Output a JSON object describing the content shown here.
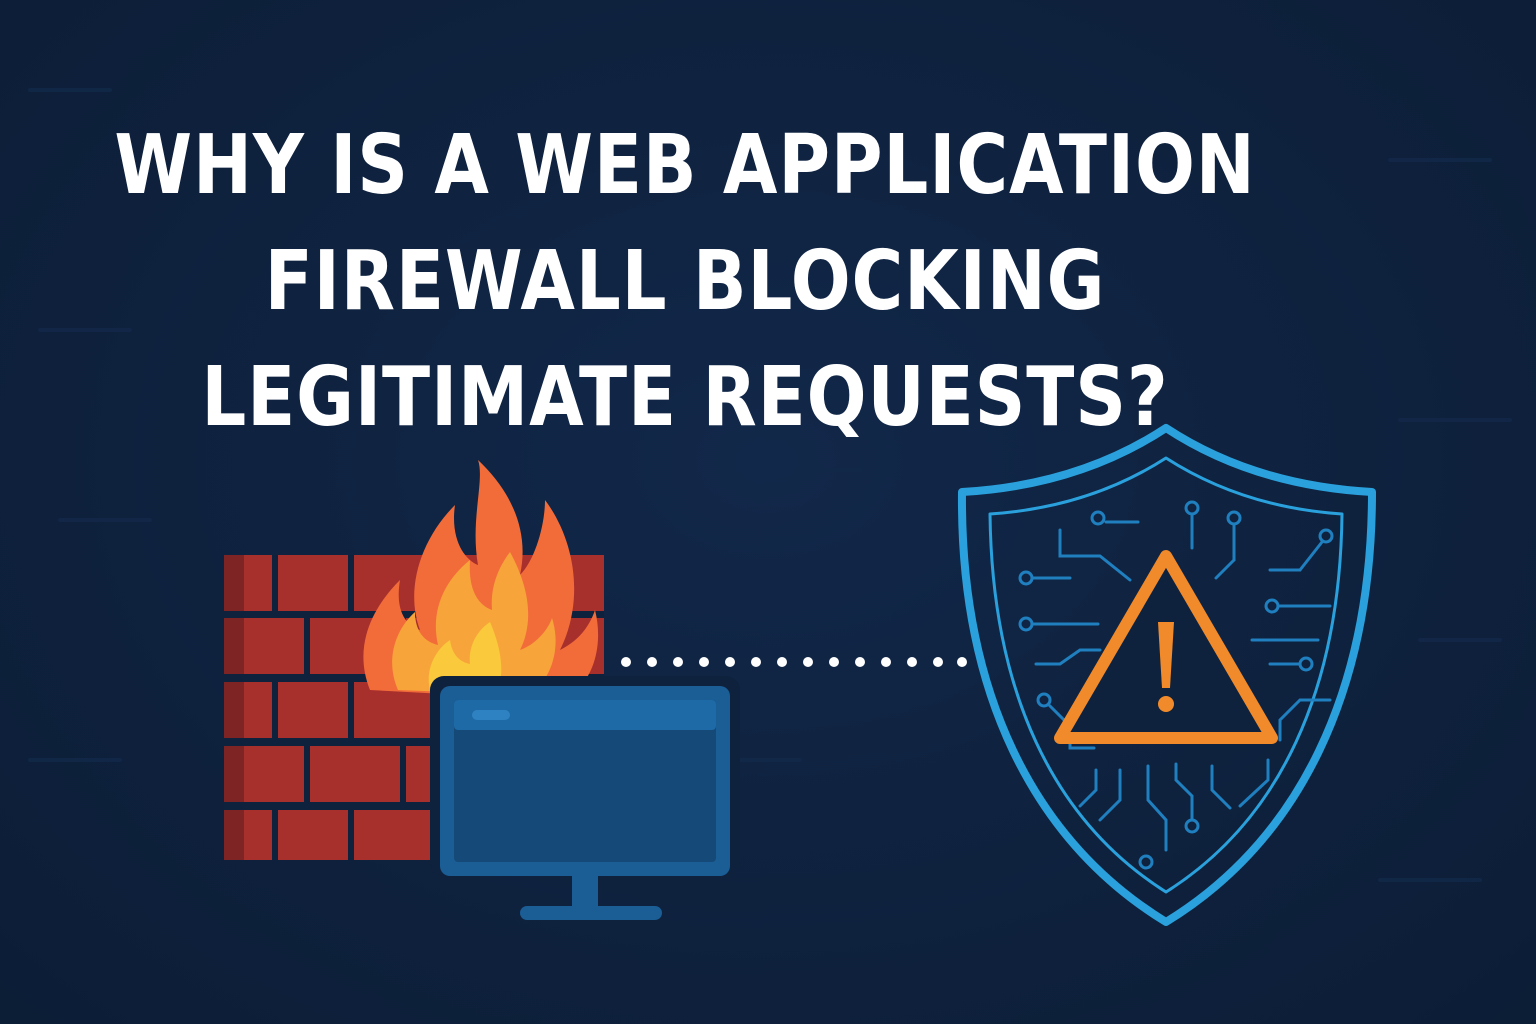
{
  "headline": {
    "line1": "WHY IS A WEB APPLICATION",
    "line2": "FIREWALL BLOCKING",
    "line3": "LEGITIMATE REQUESTS?"
  },
  "icons": [
    "brick-firewall-icon",
    "flame-icon",
    "computer-monitor-icon",
    "shield-icon",
    "warning-triangle-icon",
    "circuit-pattern"
  ],
  "colors": {
    "background": "#0e213d",
    "headline": "#ffffff",
    "brick": "#a8302c",
    "brick_shadow": "#7e2424",
    "flame_outer": "#f26c3a",
    "flame_inner": "#f7a53a",
    "monitor": "#1b5d95",
    "monitor_screen": "#154a78",
    "shield": "#2aa1dc",
    "warning": "#f08a2a",
    "dots": "#ffffff"
  }
}
